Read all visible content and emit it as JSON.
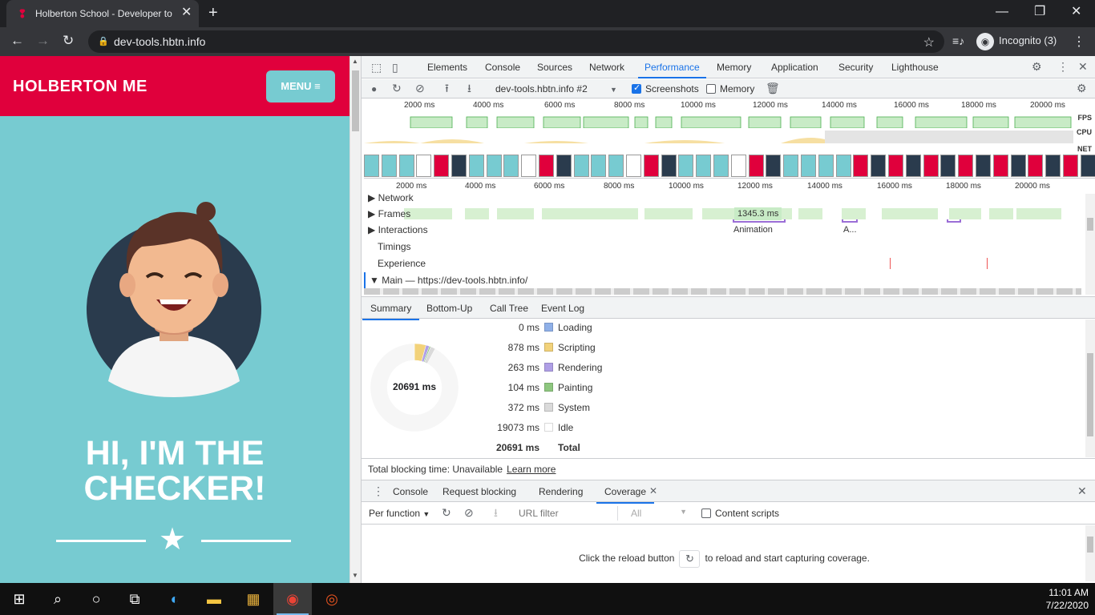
{
  "browser": {
    "tab_title": "Holberton School - Developer to",
    "new_tab": "+",
    "url": "dev-tools.hbtn.info",
    "incognito_label": "Incognito (3)"
  },
  "page": {
    "brand": "HOLBERTON ME",
    "menu_label": "MENU ≡",
    "hero_line1": "HI, I'M THE",
    "hero_line2": "CHECKER!"
  },
  "devtools": {
    "tabs": [
      "Elements",
      "Console",
      "Sources",
      "Network",
      "Performance",
      "Memory",
      "Application",
      "Security",
      "Lighthouse"
    ],
    "active_tab": "Performance",
    "profile_select": "dev-tools.hbtn.info #2",
    "screenshots_label": "Screenshots",
    "memory_label": "Memory",
    "ruler_top": [
      "2000 ms",
      "4000 ms",
      "6000 ms",
      "8000 ms",
      "10000 ms",
      "12000 ms",
      "14000 ms",
      "16000 ms",
      "18000 ms",
      "20000 ms"
    ],
    "ruler_main": [
      "2000 ms",
      "4000 ms",
      "6000 ms",
      "8000 ms",
      "10000 ms",
      "12000 ms",
      "14000 ms",
      "16000 ms",
      "18000 ms",
      "20000 ms"
    ],
    "overview_labels": {
      "fps": "FPS",
      "cpu": "CPU",
      "net": "NET"
    },
    "tracks": {
      "network": "Network",
      "frames": "Frames",
      "frame_badge": "1345.3 ms",
      "interactions": "Interactions",
      "interaction_1": "Animation",
      "interaction_2": "A...",
      "timings": "Timings",
      "experience": "Experience",
      "main": "Main — https://dev-tools.hbtn.info/"
    },
    "bottom_tabs": [
      "Summary",
      "Bottom-Up",
      "Call Tree",
      "Event Log"
    ],
    "summary": {
      "total_center": "20691 ms",
      "rows": [
        {
          "ms": "0 ms",
          "name": "Loading",
          "color": "#8fb0e8"
        },
        {
          "ms": "878 ms",
          "name": "Scripting",
          "color": "#f2d27a"
        },
        {
          "ms": "263 ms",
          "name": "Rendering",
          "color": "#af9fe6"
        },
        {
          "ms": "104 ms",
          "name": "Painting",
          "color": "#8ec77f"
        },
        {
          "ms": "372 ms",
          "name": "System",
          "color": "#dadada"
        },
        {
          "ms": "19073 ms",
          "name": "Idle",
          "color": "#ffffff"
        }
      ],
      "total_ms": "20691 ms",
      "total_label": "Total"
    },
    "tbt_text": "Total blocking time: Unavailable",
    "tbt_link": "Learn more",
    "drawer_tabs": [
      "Console",
      "Request blocking",
      "Rendering",
      "Coverage"
    ],
    "coverage": {
      "per_function": "Per function",
      "url_filter_placeholder": "URL filter",
      "type_select": "All",
      "content_scripts": "Content scripts",
      "msg_before": "Click the reload button",
      "msg_after": "to reload and start capturing coverage."
    }
  },
  "taskbar": {
    "time": "11:01 AM",
    "date": "7/22/2020"
  },
  "colors": {
    "brand_red": "#e0003c",
    "teal": "#77cbd1",
    "devtools_blue": "#1a73e8"
  }
}
